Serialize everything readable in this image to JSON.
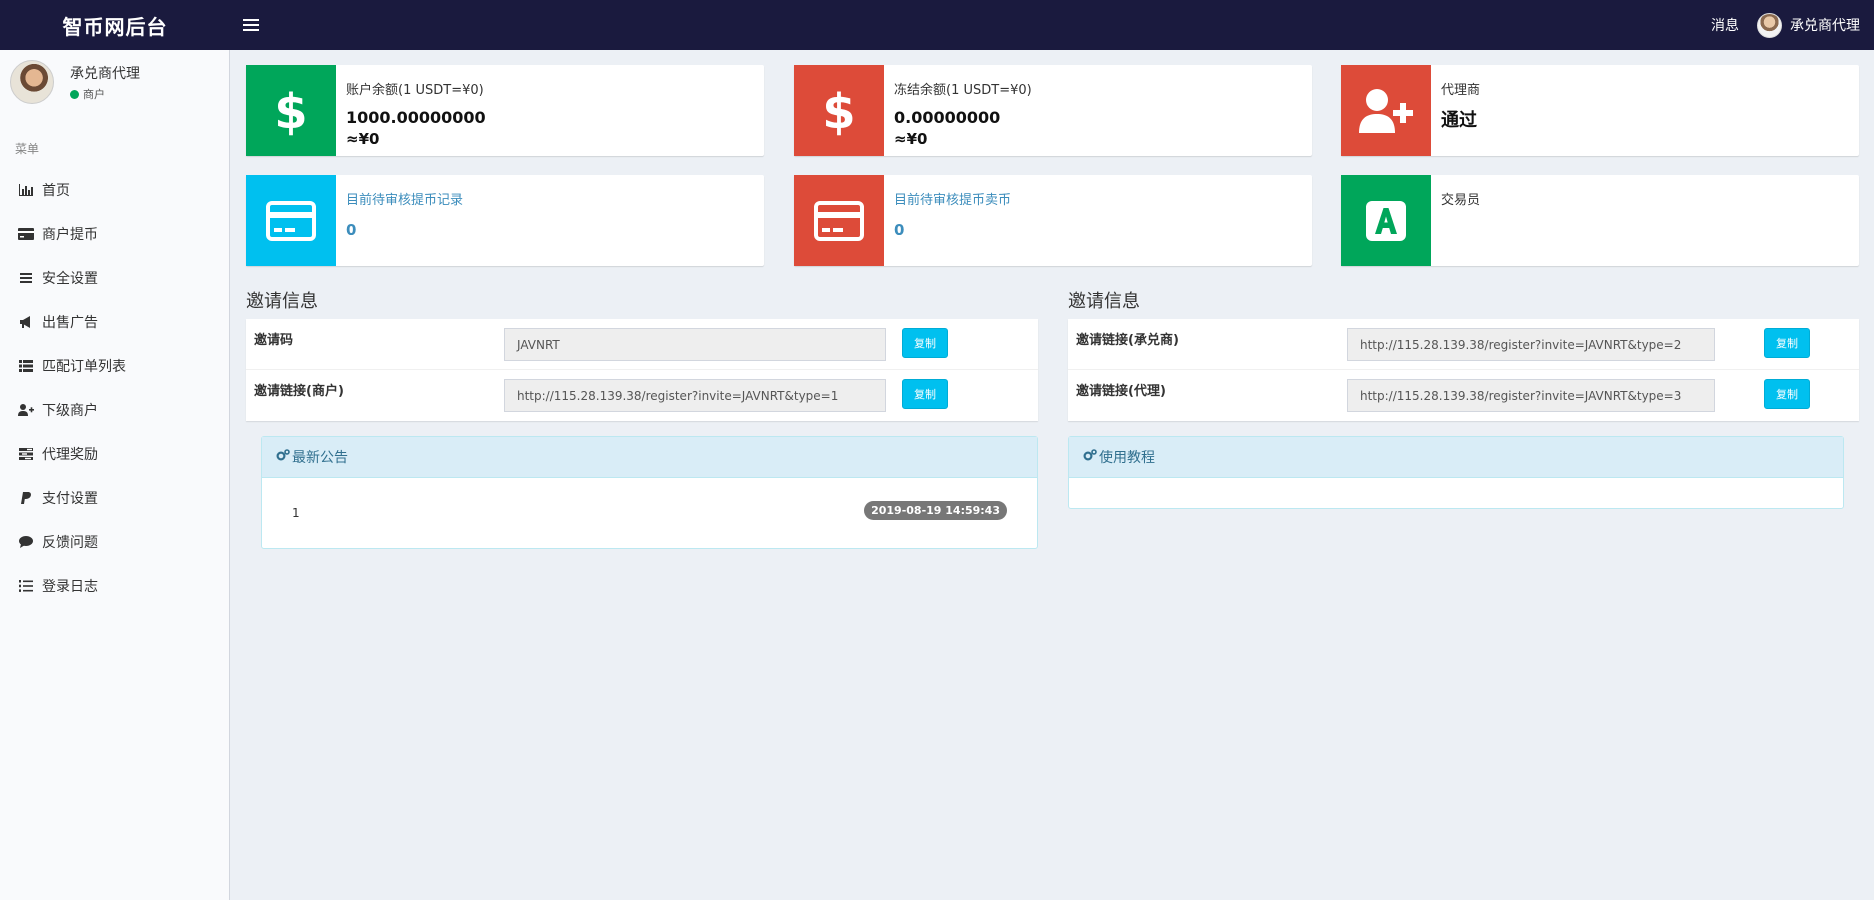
{
  "app": {
    "brand": "智币网后台"
  },
  "topbar": {
    "messages": "消息",
    "user": "承兑商代理"
  },
  "sidebar": {
    "user_name": "承兑商代理",
    "user_role": "商户",
    "menu_header": "菜单",
    "items": [
      {
        "label": "首页",
        "icon": "bar-chart-icon"
      },
      {
        "label": "商户提币",
        "icon": "credit-card-icon"
      },
      {
        "label": "安全设置",
        "icon": "list-icon"
      },
      {
        "label": "出售广告",
        "icon": "bullhorn-icon"
      },
      {
        "label": "匹配订单列表",
        "icon": "th-list-icon"
      },
      {
        "label": "下级商户",
        "icon": "user-plus-icon"
      },
      {
        "label": "代理奖励",
        "icon": "tasks-icon"
      },
      {
        "label": "支付设置",
        "icon": "paypal-icon"
      },
      {
        "label": "反馈问题",
        "icon": "comment-icon"
      },
      {
        "label": "登录日志",
        "icon": "list-ol-icon"
      }
    ]
  },
  "boxes": [
    {
      "label": "账户余额(1 USDT=¥0)",
      "value": "1000.00000000",
      "sub": "≈¥0",
      "icon": "dollar-icon",
      "color": "#00a65a"
    },
    {
      "label": "冻结余额(1 USDT=¥0)",
      "value": "0.00000000",
      "sub": "≈¥0",
      "icon": "dollar-icon",
      "color": "#dd4b39"
    },
    {
      "label": "代理商",
      "value": "通过",
      "icon": "user-plus-icon",
      "color": "#dd4b39"
    },
    {
      "label": "目前待审核提币记录",
      "value": "0",
      "icon": "credit-card-icon",
      "color": "#00c0ef"
    },
    {
      "label": "目前待审核提币卖币",
      "value": "0",
      "icon": "credit-card-icon",
      "color": "#dd4b39"
    },
    {
      "label": "交易员",
      "icon": "font-a-icon",
      "color": "#00a65a"
    }
  ],
  "invite_left": {
    "title": "邀请信息",
    "rows": [
      {
        "label": "邀请码",
        "value": "JAVNRT",
        "button": "复制"
      },
      {
        "label": "邀请链接(商户)",
        "value": "http://115.28.139.38/register?invite=JAVNRT&type=1",
        "button": "复制"
      }
    ]
  },
  "invite_right": {
    "title": "邀请信息",
    "rows": [
      {
        "label": "邀请链接(承兑商)",
        "value": "http://115.28.139.38/register?invite=JAVNRT&type=2",
        "button": "复制"
      },
      {
        "label": "邀请链接(代理)",
        "value": "http://115.28.139.38/register?invite=JAVNRT&type=3",
        "button": "复制"
      }
    ]
  },
  "notice_panel": {
    "title": "最新公告",
    "item_text": "1",
    "item_time": "2019-08-19 14:59:43"
  },
  "tutorial_panel": {
    "title": "使用教程"
  }
}
